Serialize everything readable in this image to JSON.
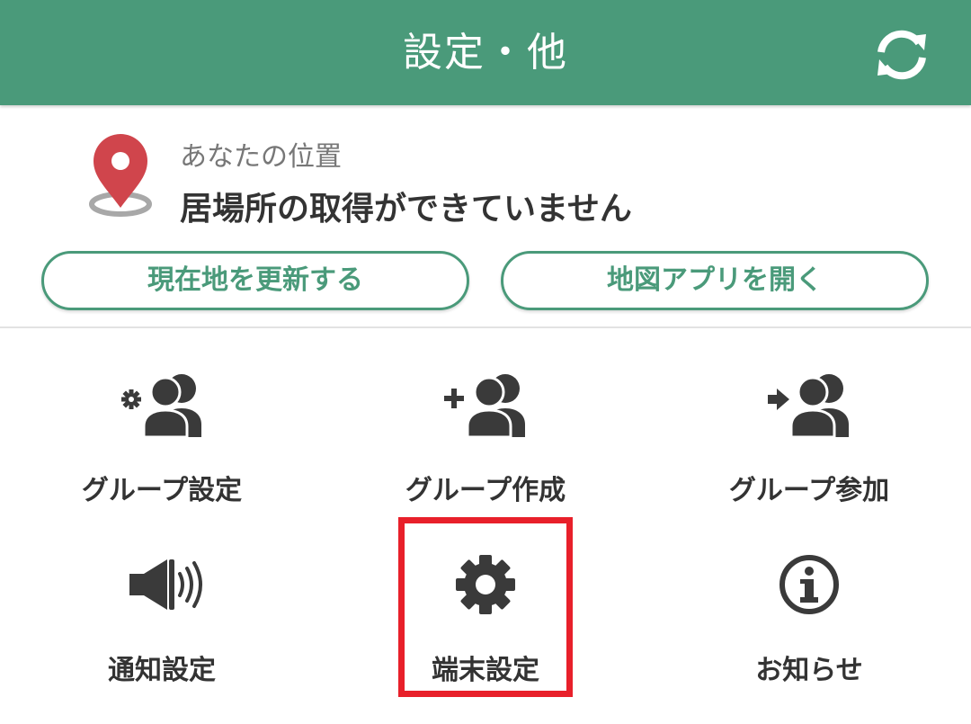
{
  "header": {
    "title": "設定・他",
    "refresh_icon": "refresh-icon",
    "background": "#4a9a7a"
  },
  "location": {
    "caption": "あなたの位置",
    "status": "居場所の取得ができていません",
    "pin_icon": "location-pin-icon",
    "pin_color": "#d0454c"
  },
  "actions": {
    "update_label": "現在地を更新する",
    "map_label": "地図アプリを開く",
    "accent": "#4a9a7a"
  },
  "menu": {
    "items": [
      {
        "label": "グループ設定",
        "icon": "group-settings-icon"
      },
      {
        "label": "グループ作成",
        "icon": "group-add-icon"
      },
      {
        "label": "グループ参加",
        "icon": "group-join-icon"
      },
      {
        "label": "通知設定",
        "icon": "speaker-icon"
      },
      {
        "label": "端末設定",
        "icon": "gear-icon"
      },
      {
        "label": "お知らせ",
        "icon": "info-icon"
      }
    ],
    "highlight_color": "#e8202a"
  }
}
